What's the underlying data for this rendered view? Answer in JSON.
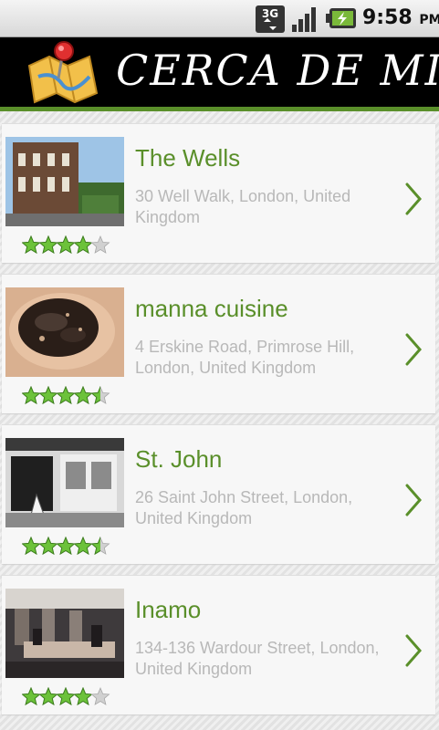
{
  "status_bar": {
    "network": "3G",
    "time": "9:58",
    "ampm": "PM",
    "icons": [
      "3g-data-icon",
      "signal-icon",
      "battery-charging-icon"
    ]
  },
  "header": {
    "title": "CERCA DE MI",
    "icon": "map-pin-icon",
    "accent_color": "#5a8f2a"
  },
  "places": [
    {
      "name": "The Wells",
      "address": "30 Well Walk, London, United Kingdom",
      "rating": 4.0,
      "thumb_theme": "building"
    },
    {
      "name": "manna cuisine",
      "address": "4 Erskine Road, Primrose Hill, London, United Kingdom",
      "rating": 4.5,
      "thumb_theme": "food"
    },
    {
      "name": "St. John",
      "address": "26 Saint John Street, London, United Kingdom",
      "rating": 4.5,
      "thumb_theme": "storefront"
    },
    {
      "name": "Inamo",
      "address": "134-136 Wardour Street, London, United Kingdom",
      "rating": 4.0,
      "thumb_theme": "interior"
    }
  ]
}
